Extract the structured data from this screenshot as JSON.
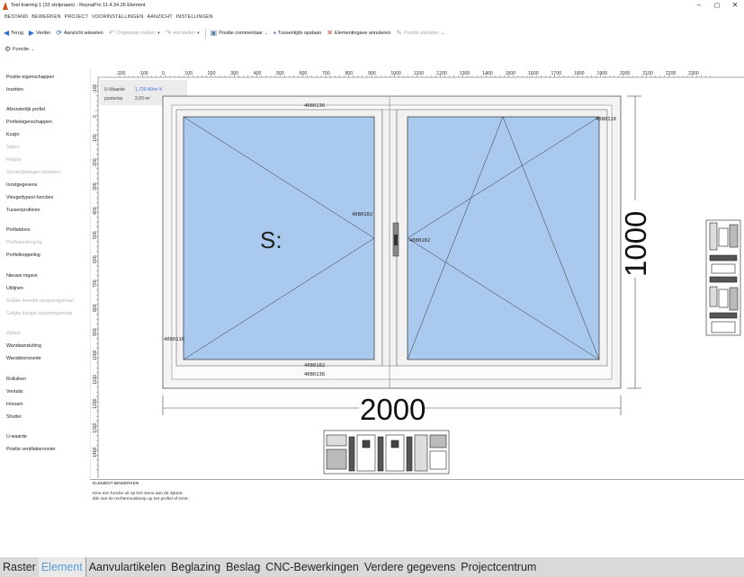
{
  "window": {
    "title": "Test training 1 (33 stolpraam) - ReynaPro 11.4.34.26 Element",
    "controls": [
      "–",
      "◻",
      "✕"
    ]
  },
  "menu": [
    "BESTAND",
    "BEWERKEN",
    "PROJECT",
    "VOORINSTELLINGEN",
    "AANZICHT",
    "INSTELLINGEN"
  ],
  "toolbar": {
    "back": "Terug",
    "forward": "Verder",
    "switch_view": "Aanzicht wisselen",
    "undo": "Ongedaan maken",
    "redo": "Herstellen",
    "position_comment": "Positie commentaar",
    "save_intermediate": "Tussentijds opslaan",
    "cancel_element": "Elementingave annuleren",
    "close_position": "Positie afsluiten",
    "function": "Functie"
  },
  "sidebar": {
    "items": [
      {
        "label": "Positie eigenschappen",
        "enabled": true
      },
      {
        "label": "Inzetten",
        "enabled": true
      },
      {
        "label": "Afzonderlijk profiel",
        "enabled": true
      },
      {
        "label": "Profieleigenschappen",
        "enabled": true
      },
      {
        "label": "Kozijn",
        "enabled": true
      },
      {
        "label": "Stijlen",
        "enabled": false
      },
      {
        "label": "Regels",
        "enabled": false
      },
      {
        "label": "Schuin/gebogen profielen",
        "enabled": false
      },
      {
        "label": "Inzetgegevens",
        "enabled": true
      },
      {
        "label": "Vleugeltypen/-functies",
        "enabled": true
      },
      {
        "label": "Tussenprofielen",
        "enabled": true
      },
      {
        "label": "Profieldoos",
        "enabled": true
      },
      {
        "label": "Profielverlenging",
        "enabled": false
      },
      {
        "label": "Profielkoppeling",
        "enabled": true
      },
      {
        "label": "Nieuwe ingave",
        "enabled": true
      },
      {
        "label": "Uitlijnen",
        "enabled": true
      },
      {
        "label": "Gelijke breedte opsporingsmaat",
        "enabled": false
      },
      {
        "label": "Gelijke hoogte opsporingsmaat",
        "enabled": false
      },
      {
        "label": "Zijdeel",
        "enabled": false
      },
      {
        "label": "Wandaansluiting",
        "enabled": true
      },
      {
        "label": "Wanddoorsnede",
        "enabled": true
      },
      {
        "label": "Rolluiken",
        "enabled": true
      },
      {
        "label": "Ventalis",
        "enabled": true
      },
      {
        "label": "Horsam",
        "enabled": true
      },
      {
        "label": "Shutter",
        "enabled": true
      },
      {
        "label": "U-waarde",
        "enabled": true
      },
      {
        "label": "Positie ventilatierooster",
        "enabled": true
      }
    ]
  },
  "drawing": {
    "ruler_top": [
      "-200",
      "-100",
      "0",
      "100",
      "200",
      "300",
      "400",
      "500",
      "600",
      "700",
      "800",
      "900",
      "1000",
      "1100",
      "1200",
      "1300",
      "1400",
      "1500",
      "1600",
      "1700",
      "1800",
      "1900",
      "2000",
      "2100",
      "2200",
      "2300"
    ],
    "ruler_left": [
      "-100",
      "0",
      "100",
      "200",
      "300",
      "400",
      "500",
      "600",
      "700",
      "800",
      "900",
      "1000",
      "1100",
      "1200",
      "1300",
      "1400"
    ],
    "info_uwaarde_label": "U-Waarde",
    "info_uwaarde_value": "1,720 W/m² K",
    "info_posterias_label": "posterias",
    "info_posterias_value": "2,00 m²",
    "profile_top": "4080136",
    "profile_right": "4080116",
    "profile_left": "4080116",
    "profile_mid_left": "4080102",
    "profile_mid_right": "4080102",
    "profile_bottom_inner": "4080102",
    "profile_bottom": "4080136",
    "sash_marker": "S:",
    "width_dim": "2000",
    "height_dim": "1000"
  },
  "message_panel": {
    "title": "ELEMENT BEWERKEN",
    "line1": "Kies een functie uit op het menu aan de zijkant.",
    "line2": "klik met de rechtermuisknop op het profiel of inzet."
  },
  "tabs": [
    "Raster",
    "Element",
    "Aanvulartikelen",
    "Beglazing",
    "Beslag",
    "CNC-Bewerkingen",
    "Verdere gegevens",
    "Projectcentrum"
  ],
  "active_tab": "Element",
  "colors": {
    "glass": "#a9c9ee",
    "accent": "#5b9bd5",
    "tabs_bg": "#d9d9d9"
  }
}
